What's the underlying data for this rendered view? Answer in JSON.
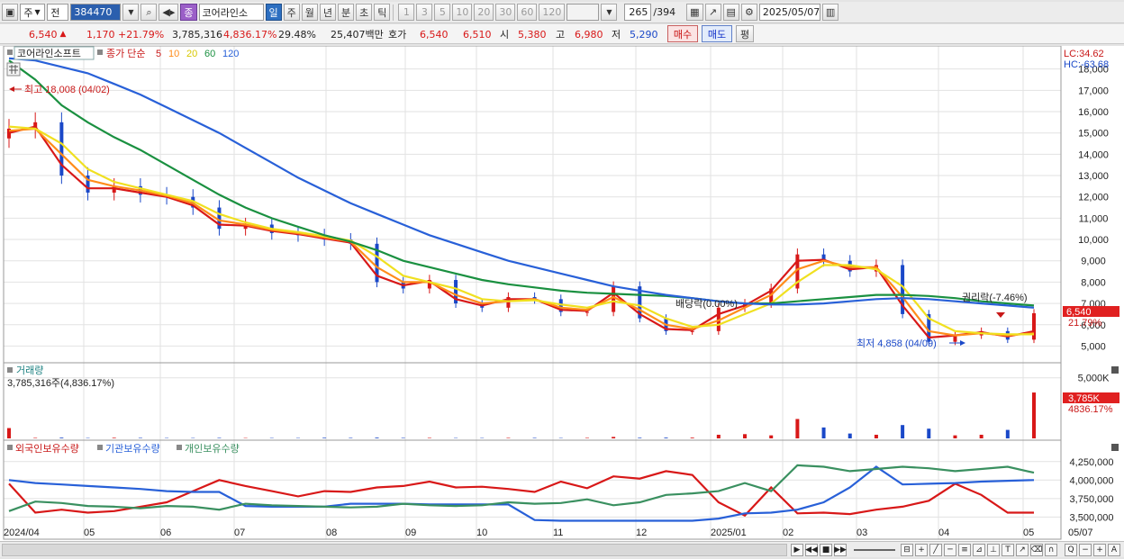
{
  "toolbar": {
    "market": "주",
    "type": "전",
    "code": "384470",
    "name_badge": "종",
    "name": "코어라인소",
    "periods": [
      "일",
      "주",
      "월",
      "년",
      "분",
      "초",
      "틱"
    ],
    "active_period": "일",
    "intervals": [
      "1",
      "3",
      "5",
      "10",
      "20",
      "30",
      "60",
      "120"
    ],
    "count": "265",
    "total": "/394",
    "date": "2025/05/07"
  },
  "quote": {
    "price": "6,540",
    "change": "1,170",
    "change_pct": "+21.79%",
    "volume": "3,785,316",
    "volume_pct": "4,836.17%",
    "turnover": "29.48%",
    "amount": "25,407백만",
    "bid_label": "호가",
    "bid1": "6,540",
    "bid2": "6,510",
    "open_label": "시",
    "open": "5,380",
    "high_label": "고",
    "high": "6,980",
    "low_label": "저",
    "low": "5,290",
    "buy": "매수",
    "sell": "매도",
    "flat": "평"
  },
  "colors": {
    "up": "#d81818",
    "down": "#1a48c8",
    "ma5": "#d81818",
    "ma10": "#ff8c1a",
    "ma20": "#f0e020",
    "ma60": "#1a9040",
    "ma120": "#2860d8",
    "foreign": "#d81818",
    "inst": "#2860d8",
    "indiv": "#3a9060"
  },
  "legend": {
    "stock": "코어라인소프트",
    "title": "종가 단순",
    "ma5": "5",
    "ma10": "10",
    "ma20": "20",
    "ma60": "60",
    "ma120": "120"
  },
  "annotations": {
    "lc": "LC:34.62",
    "hc": "HC:-63.68",
    "high": "최고 18,008 (04/02)",
    "low": "최저 4,858 (04/09)",
    "rights": "권리락(-7.46%)",
    "nodrop": "배당락(0.00%)",
    "cur_price": "6,540",
    "cur_pct": "21.79%",
    "vol_title": "거래량",
    "vol_info": "3,785,316주(4,836.17%)",
    "vol_cur": "3,785K",
    "vol_pct": "4836.17%",
    "hold_foreign": "외국인보유수량",
    "hold_inst": "기관보유수량",
    "hold_indiv": "개인보유수량"
  },
  "chart_data": [
    {
      "type": "candlestick",
      "title": "코어라인소프트",
      "x_ticks": [
        "2024/04",
        "05",
        "06",
        "07",
        "08",
        "09",
        "10",
        "11",
        "12",
        "2025/01",
        "02",
        "03",
        "04",
        "05",
        "05/07"
      ],
      "y_ticks": [
        18000,
        17000,
        16000,
        15000,
        14000,
        13000,
        12000,
        11000,
        10000,
        9000,
        8000,
        7000,
        6000,
        5000
      ],
      "ylim": [
        4300,
        19000
      ],
      "series": [
        {
          "name": "종가",
          "values": [
            15200,
            15500,
            13000,
            12200,
            12500,
            12100,
            12000,
            11500,
            10500,
            10700,
            10300,
            10200,
            10000,
            9800,
            8000,
            7700,
            8100,
            7000,
            6800,
            7300,
            7200,
            6600,
            6600,
            7800,
            6300,
            5700,
            5700,
            6800,
            7000,
            7700,
            9300,
            9000,
            8500,
            8800,
            6500,
            5200,
            5500,
            5700,
            5300,
            6540
          ]
        },
        {
          "name": "5",
          "values": [
            15000,
            15300,
            13500,
            12400,
            12400,
            12200,
            12000,
            11600,
            10700,
            10650,
            10400,
            10250,
            10050,
            9850,
            8300,
            7850,
            8050,
            7200,
            6900,
            7200,
            7200,
            6700,
            6650,
            7500,
            6500,
            5800,
            5750,
            6500,
            6900,
            7600,
            9000,
            9050,
            8600,
            8700,
            6900,
            5400,
            5500,
            5650,
            5450,
            5700
          ]
        },
        {
          "name": "10",
          "values": [
            15100,
            15200,
            14000,
            12800,
            12500,
            12300,
            12050,
            11700,
            10900,
            10700,
            10450,
            10300,
            10100,
            9900,
            8700,
            8000,
            8000,
            7400,
            7000,
            7100,
            7200,
            6800,
            6700,
            7300,
            6700,
            6000,
            5800,
            6200,
            6800,
            7400,
            8600,
            9000,
            8700,
            8700,
            7300,
            5700,
            5500,
            5600,
            5500,
            5600
          ]
        },
        {
          "name": "20",
          "values": [
            15300,
            15200,
            14500,
            13300,
            12700,
            12400,
            12100,
            11800,
            11200,
            10800,
            10500,
            10350,
            10150,
            9950,
            9200,
            8300,
            8000,
            7700,
            7200,
            7100,
            7150,
            6950,
            6800,
            7100,
            6900,
            6300,
            5900,
            6000,
            6500,
            7000,
            8000,
            8800,
            8800,
            8600,
            7800,
            6300,
            5700,
            5600,
            5550,
            5550
          ]
        },
        {
          "name": "60",
          "values": [
            18400,
            17500,
            16300,
            15500,
            14800,
            14200,
            13500,
            12800,
            12100,
            11500,
            11000,
            10600,
            10200,
            9900,
            9500,
            9000,
            8700,
            8400,
            8100,
            7900,
            7750,
            7600,
            7500,
            7450,
            7400,
            7350,
            7250,
            7100,
            7000,
            7000,
            7100,
            7200,
            7300,
            7400,
            7400,
            7350,
            7250,
            7100,
            7000,
            6900
          ]
        },
        {
          "name": "120",
          "values": [
            18500,
            18400,
            18100,
            17800,
            17300,
            16800,
            16200,
            15600,
            15000,
            14300,
            13600,
            12900,
            12300,
            11700,
            11200,
            10700,
            10200,
            9800,
            9400,
            9000,
            8700,
            8400,
            8100,
            7800,
            7600,
            7400,
            7250,
            7100,
            7000,
            6950,
            6950,
            7000,
            7100,
            7200,
            7250,
            7200,
            7100,
            7000,
            6900,
            6800
          ]
        }
      ]
    },
    {
      "type": "bar",
      "title": "거래량",
      "y_ticks": [
        "5,000K"
      ],
      "values_k": [
        850,
        40,
        60,
        30,
        50,
        40,
        30,
        30,
        40,
        30,
        30,
        30,
        50,
        40,
        60,
        40,
        40,
        30,
        30,
        40,
        40,
        30,
        40,
        120,
        50,
        60,
        60,
        300,
        350,
        250,
        1600,
        900,
        400,
        300,
        1100,
        800,
        250,
        300,
        700,
        3785
      ]
    },
    {
      "type": "line",
      "title": "보유수량",
      "y_ticks": [
        4250000,
        4000000,
        3750000,
        3500000
      ],
      "ylim": [
        3420000,
        4320000
      ],
      "series": [
        {
          "name": "외국인보유수량",
          "values": [
            3950000,
            3560000,
            3600000,
            3560000,
            3580000,
            3640000,
            3700000,
            3850000,
            4000000,
            3920000,
            3850000,
            3780000,
            3850000,
            3840000,
            3900000,
            3920000,
            3980000,
            3900000,
            3910000,
            3880000,
            3840000,
            3980000,
            3890000,
            4050000,
            4020000,
            4120000,
            4070000,
            3700000,
            3520000,
            3900000,
            3550000,
            3560000,
            3540000,
            3600000,
            3640000,
            3720000,
            3950000,
            3800000,
            3560000,
            3560000
          ]
        },
        {
          "name": "기관보유수량",
          "values": [
            4000000,
            3960000,
            3940000,
            3920000,
            3900000,
            3880000,
            3850000,
            3840000,
            3840000,
            3650000,
            3640000,
            3640000,
            3640000,
            3680000,
            3680000,
            3680000,
            3670000,
            3670000,
            3670000,
            3670000,
            3460000,
            3450000,
            3450000,
            3450000,
            3450000,
            3450000,
            3450000,
            3480000,
            3550000,
            3560000,
            3600000,
            3700000,
            3900000,
            4180000,
            3940000,
            3950000,
            3960000,
            3980000,
            3990000,
            4000000
          ]
        },
        {
          "name": "개인보유수량",
          "values": [
            3580000,
            3710000,
            3690000,
            3650000,
            3640000,
            3620000,
            3650000,
            3640000,
            3600000,
            3680000,
            3660000,
            3650000,
            3640000,
            3630000,
            3640000,
            3680000,
            3660000,
            3650000,
            3660000,
            3700000,
            3680000,
            3690000,
            3740000,
            3660000,
            3700000,
            3800000,
            3820000,
            3850000,
            3960000,
            3850000,
            4200000,
            4180000,
            4120000,
            4150000,
            4180000,
            4160000,
            4120000,
            4150000,
            4180000,
            4100000
          ]
        }
      ]
    }
  ]
}
